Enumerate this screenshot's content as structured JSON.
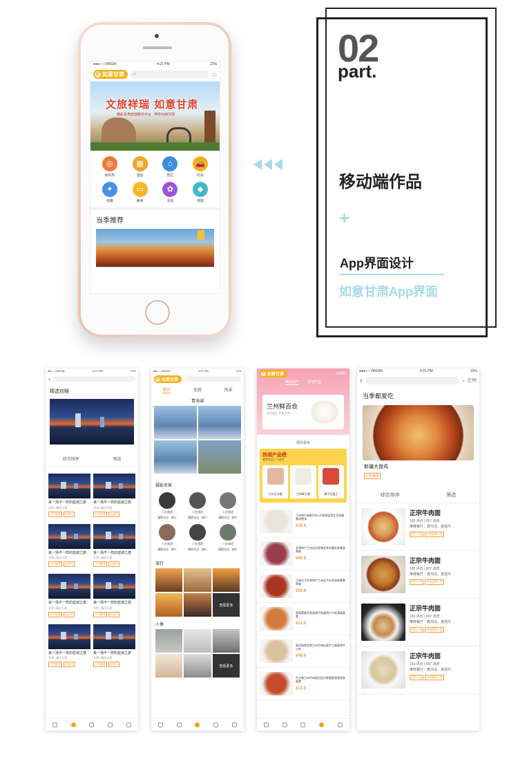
{
  "phone": {
    "status_carrier": "●●●○○ VIRGIN",
    "status_time": "4:21 PM",
    "status_battery": "22%",
    "logo_text": "如意甘肃",
    "banner_title": "文旅祥瑞 如意甘肃",
    "banner_subtitle": "精彩甘肃旅游服务平台 · 带你玩转甘肃",
    "icons": [
      {
        "label": "目的地",
        "icon": "destination-icon",
        "color": "#f07a3c",
        "glyph": "◎"
      },
      {
        "label": "酒店",
        "icon": "hotel-icon",
        "color": "#f4a42a",
        "glyph": "▦"
      },
      {
        "label": "景区",
        "icon": "scenic-icon",
        "color": "#3e8be0",
        "glyph": "⌂"
      },
      {
        "label": "约车",
        "icon": "car-icon",
        "color": "#f4b21f",
        "glyph": "🚗"
      },
      {
        "label": "线路",
        "icon": "route-icon",
        "color": "#4a8fe6",
        "glyph": "✦"
      },
      {
        "label": "美食",
        "icon": "food-icon",
        "color": "#f5b625",
        "glyph": "▭"
      },
      {
        "label": "活动",
        "icon": "activity-icon",
        "color": "#9a56d9",
        "glyph": "✿"
      },
      {
        "label": "地图",
        "icon": "map-icon",
        "color": "#41b7c9",
        "glyph": "◆"
      }
    ],
    "section_title": "当季推荐"
  },
  "heading": {
    "number": "02",
    "part": "part.",
    "title": "移动端作品",
    "plus": "+",
    "subtitle": "App界面设计",
    "subtitle2": "如意甘肃App界面"
  },
  "screen1": {
    "section": "精选攻略",
    "sort": "综合排序",
    "filter": "筛选",
    "card_title": "来一场不一样的蓝城之旅",
    "card_meta": "甘肃 | 精品行程",
    "tags": [
      "人气推荐",
      "自由行"
    ]
  },
  "screen2": {
    "logo_text": "如意甘肃",
    "tabs": [
      "照片",
      "毛孩",
      "风采"
    ],
    "lake_title": "青海湖",
    "people_title": "摄影名家",
    "person_caption": "人在旅途",
    "person_sub": "摄影作品 · 旅行",
    "travel_title": "旅行",
    "portrait_title": "人像",
    "more": "查看更多"
  },
  "screen3": {
    "logo_text": "如意甘肃",
    "top_right": "去我意见",
    "tabs": [
      "精选特产",
      "当地产品"
    ],
    "banner_title": "兰州鲜百合",
    "banner_sub": "百年老店 甘肃 正宗",
    "guess": "猜你喜欢",
    "hot_title": "热销产品榜",
    "hot_sub": "最受欢迎人气推荐",
    "hot_items": [
      "兰州天水猪",
      "兰州皋兰梨",
      "静宁红富士"
    ],
    "products": [
      {
        "title": "兰州特产新鲜百合1斤装家庭用生百合甜食材煲汤",
        "price": "¥39.8",
        "color": "#e9e3d8"
      },
      {
        "title": "甘肃特产兰州苦水玫瑰花茶花蕾花茶美容养颜",
        "price": "¥49.8",
        "color": "#9b3e4c"
      },
      {
        "title": "正林瓜子甘肃特产兰州瓜子炒货休闲零食原味",
        "price": "¥59.8",
        "color": "#a8371f"
      },
      {
        "title": "高原黑美甘肃高原牛肉面特产小吃清真面食",
        "price": "¥12.8",
        "color": "#d27c3b"
      },
      {
        "title": "高印面馆甘肃兰州牛肉拉面手工面条特产小吃",
        "price": "¥49.8",
        "color": "#d9c2a0"
      },
      {
        "title": "牛大碗兰州牛肉面拉面方便速食速食面条面食",
        "price": "¥12.8",
        "color": "#c54d2e"
      }
    ]
  },
  "screen4": {
    "status_time": "4:21 PM",
    "status_battery": "22%",
    "city": "兰州",
    "section": "当季都爱吃",
    "hero_caption": "新疆大盘鸡",
    "hero_tag": "必吃美食",
    "sort": "综合排序",
    "filter": "筛选",
    "items": [
      {
        "name": "正宗牛肉面",
        "stats": "165 评价 | 657 浏览",
        "rec": "推荐餐厅：磨沟沿、金强牛...",
        "tags": [
          "西沉一品",
          "牛肉面第一家"
        ]
      },
      {
        "name": "正宗牛肉面",
        "stats": "165 评价 | 657 浏览",
        "rec": "推荐餐厅：磨沟沿、金强牛...",
        "tags": [
          "西沉一品",
          "牛肉面第一家"
        ]
      },
      {
        "name": "正宗牛肉面",
        "stats": "165 评价 | 657 浏览",
        "rec": "推荐餐厅：磨沟沿、金强牛...",
        "tags": [
          "西沉一品",
          "牛肉面第一家"
        ]
      },
      {
        "name": "正宗牛肉面",
        "stats": "165 评价 | 657 浏览",
        "rec": "推荐餐厅：磨沟沿、金强牛...",
        "tags": [
          "西沉一品",
          "牛肉面第一家"
        ]
      }
    ]
  }
}
